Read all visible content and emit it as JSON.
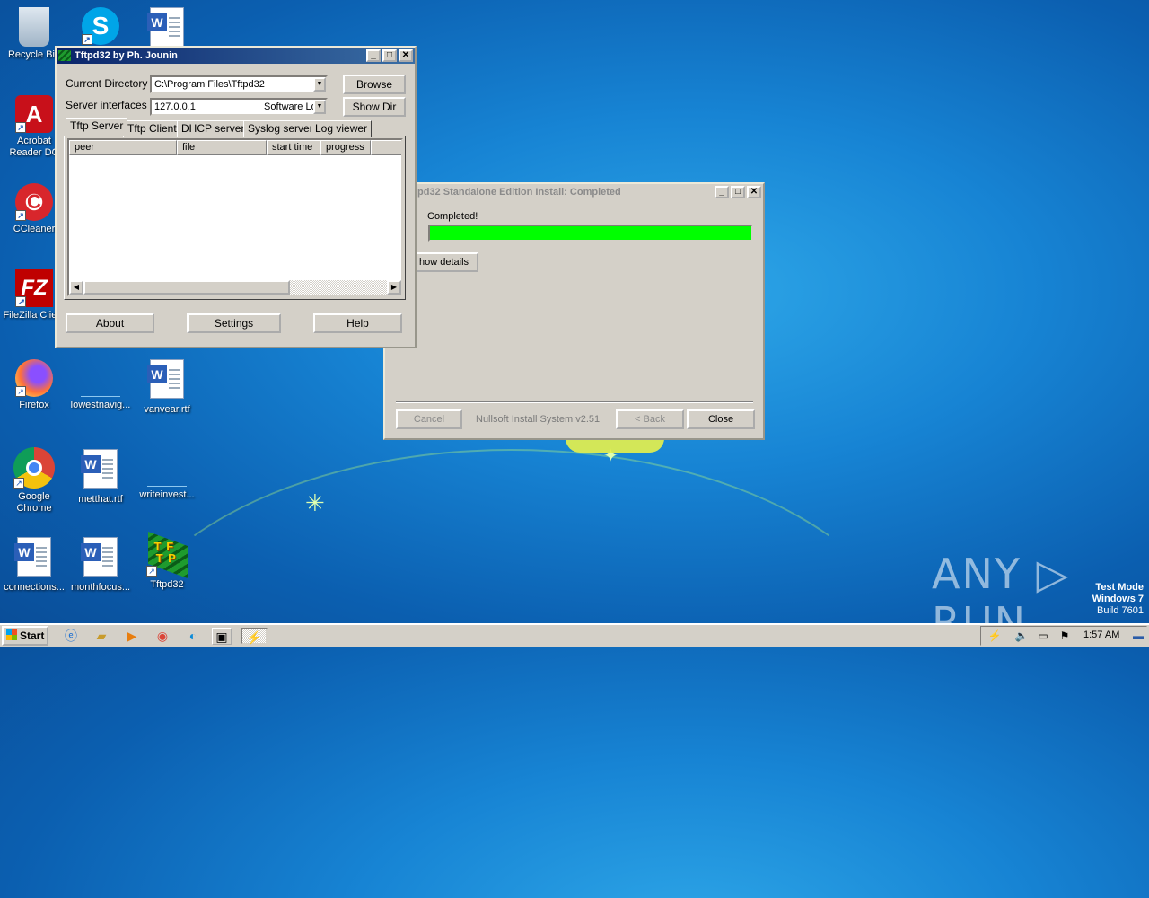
{
  "desktop": {
    "icons": [
      {
        "label": "Recycle Bin",
        "glyph": "🗑",
        "name": "recycle-bin-icon"
      },
      {
        "label": "Acrobat Reader DC",
        "glyph": "A",
        "name": "acrobat-reader-icon"
      },
      {
        "label": "CCleaner",
        "glyph": "C",
        "name": "ccleaner-icon"
      },
      {
        "label": "FileZilla Client",
        "glyph": "FZ",
        "name": "filezilla-icon"
      },
      {
        "label": "Firefox",
        "glyph": "🦊",
        "name": "firefox-icon"
      },
      {
        "label": "Google Chrome",
        "glyph": "◉",
        "name": "chrome-icon"
      },
      {
        "label": "connections...",
        "glyph": "W",
        "name": "word-document-icon"
      },
      {
        "label": "lowestnavig...",
        "glyph": "",
        "name": "file-icon"
      },
      {
        "label": "metthat.rtf",
        "glyph": "W",
        "name": "word-document-icon"
      },
      {
        "label": "monthfocus...",
        "glyph": "W",
        "name": "word-document-icon"
      },
      {
        "label": "vanvear.rtf",
        "glyph": "W",
        "name": "word-document-icon"
      },
      {
        "label": "writeinvest...",
        "glyph": "",
        "name": "file-icon"
      },
      {
        "label": "Tftpd32",
        "glyph": "TFTP",
        "name": "tftpd32-icon"
      }
    ],
    "watermark": "ANY ▷ RUN",
    "test_mode": {
      "line1": "Test Mode",
      "line2": "Windows 7",
      "line3": "Build 7601"
    }
  },
  "tftpd": {
    "title": "Tftpd32 by Ph. Jounin",
    "current_directory_label": "Current Directory",
    "current_directory_value": "C:\\Program Files\\Tftpd32",
    "server_interfaces_label": "Server interfaces",
    "server_interfaces_ip": "127.0.0.1",
    "server_interfaces_name": "Software Lo",
    "browse_label": "Browse",
    "show_dir_label": "Show Dir",
    "tabs": [
      "Tftp Server",
      "Tftp Client",
      "DHCP server",
      "Syslog server",
      "Log viewer"
    ],
    "columns": [
      "peer",
      "file",
      "start time",
      "progress"
    ],
    "about_label": "About",
    "settings_label": "Settings",
    "help_label": "Help"
  },
  "installer": {
    "title": "pd32 Standalone Edition Install: Completed",
    "status": "Completed!",
    "progress": 1.0,
    "progress_color": "#00ff00",
    "show_details_label": "how details",
    "cancel_label": "Cancel",
    "branding": "Nullsoft Install System v2.51",
    "back_label": "< Back",
    "close_label": "Close"
  },
  "taskbar": {
    "start_label": "Start",
    "clock": "1:57 AM"
  }
}
